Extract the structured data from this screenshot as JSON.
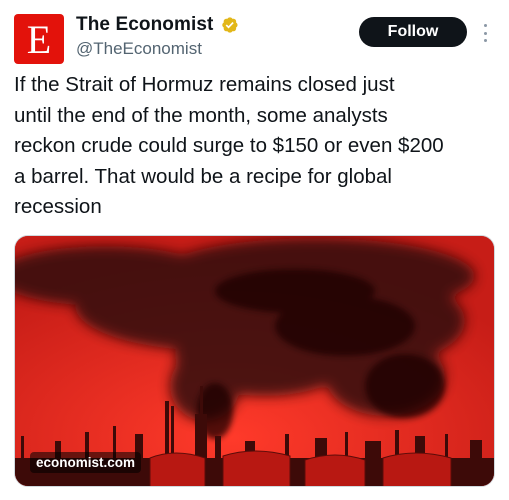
{
  "author": {
    "avatar_letter": "E",
    "display_name": "The Economist",
    "handle": "@TheEconomist",
    "verified_badge_icon": "gold-verified-badge-icon",
    "brand_color": "#e3120b"
  },
  "actions": {
    "follow_label": "Follow",
    "more_icon": "more-vertical-icon"
  },
  "post": {
    "text": "If the Strait of Hormuz remains closed just\nuntil the end of the month, some analysts\nreckon crude could surge to $150 or even $200\na barrel. That would be a recipe for global\nrecession"
  },
  "media": {
    "link_label": "economist.com",
    "tint_color": "#d8261f"
  }
}
